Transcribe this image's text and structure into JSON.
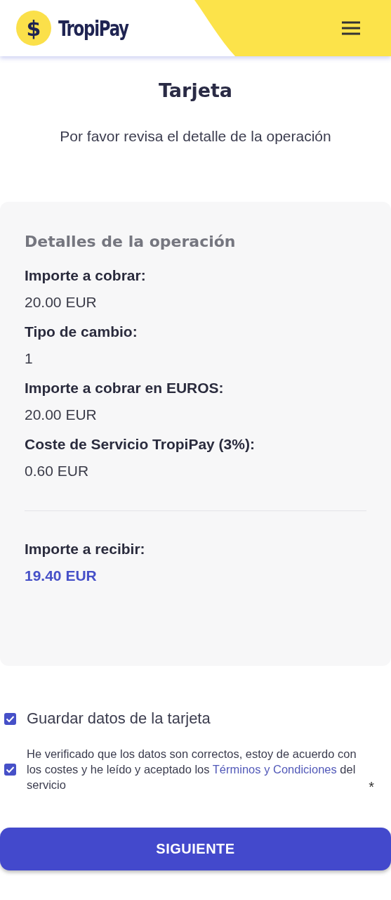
{
  "header": {
    "logo_symbol": "$",
    "logo_text": "TropiPay"
  },
  "title": "Tarjeta",
  "subtitle": "Por favor revisa el detalle de la operación",
  "details": {
    "heading": "Detalles de la operación",
    "rows": [
      {
        "label": "Importe a cobrar:",
        "value": "20.00 EUR",
        "kind": "plain"
      },
      {
        "label": "Tipo de cambio:",
        "value": "1",
        "kind": "plain"
      },
      {
        "label": "Importe a cobrar en EUROS:",
        "value": "20.00 EUR",
        "kind": "plain"
      },
      {
        "label": "Coste de Servicio TropiPay (3%):",
        "value": "0.60 EUR",
        "kind": "plain"
      },
      {
        "label": "Importe a recibir:",
        "value": "19.40 EUR",
        "kind": "total"
      }
    ]
  },
  "options": [
    {
      "kind": "simple",
      "label": "Guardar datos de la tarjeta",
      "checked": true
    },
    {
      "kind": "terms",
      "before": "He verificado que los datos son correctos, estoy de acuerdo con los costes y he leído y aceptado los",
      "link": "Términos y Condiciones",
      "after": "del servicio",
      "required_mark": "*",
      "checked": true
    }
  ],
  "button": "SIGUIENTE"
}
